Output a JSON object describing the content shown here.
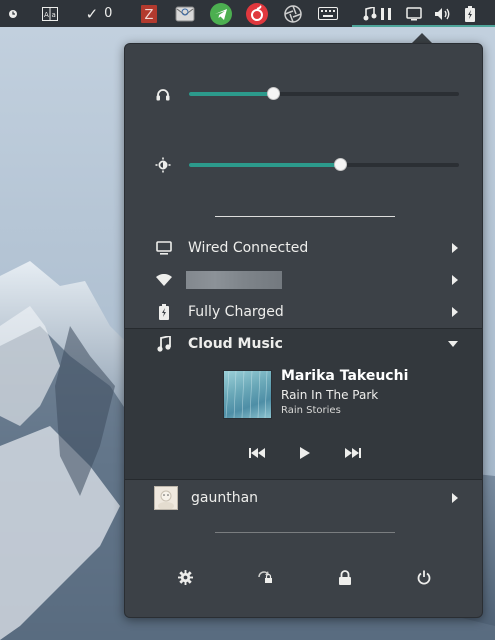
{
  "topbar": {
    "todo_count": "0"
  },
  "volume": {
    "level": 0.31
  },
  "brightness": {
    "level": 0.56
  },
  "network": {
    "wired_label": "Wired Connected",
    "wifi_label": ""
  },
  "power": {
    "battery_label": "Fully Charged"
  },
  "music": {
    "app_label": "Cloud Music",
    "artist": "Marika Takeuchi",
    "track": "Rain In The Park",
    "album": "Rain Stories"
  },
  "user": {
    "name": "gaunthan"
  },
  "colors": {
    "accent": "#2c9a8c",
    "panel_bg": "#3c4147",
    "topbar_bg": "#2f343a"
  }
}
